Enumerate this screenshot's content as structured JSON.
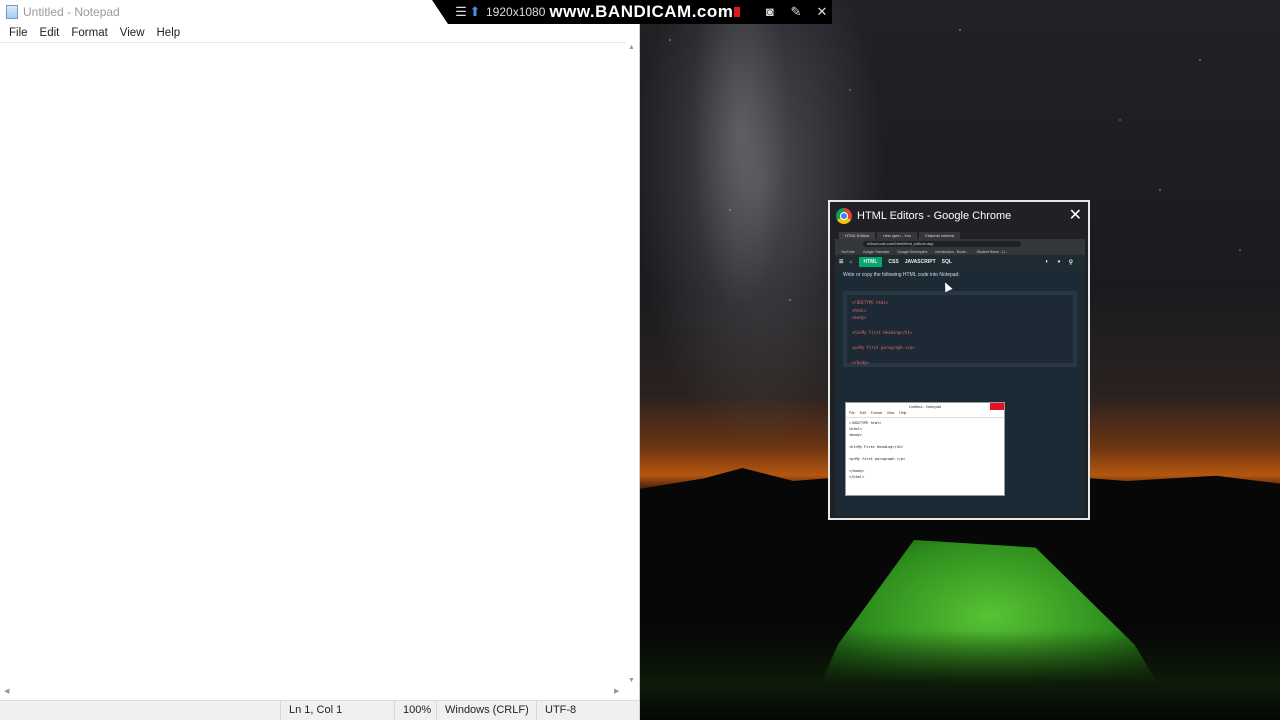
{
  "notepad": {
    "title": "Untitled - Notepad",
    "menu": [
      "File",
      "Edit",
      "Format",
      "View",
      "Help"
    ],
    "editor_text": "",
    "status": {
      "position": "Ln 1, Col 1",
      "zoom": "100%",
      "line_ending": "Windows (CRLF)",
      "encoding": "UTF-8"
    }
  },
  "bandicam": {
    "resolution": "1920x1080",
    "brand": "www.BANDICAM.com",
    "icons": [
      "menu-icon",
      "pin-icon",
      "camera-icon",
      "pencil-icon",
      "close-icon"
    ]
  },
  "chrome_popup": {
    "title": "HTML Editors - Google Chrome",
    "tabs": [
      "HTML Editors",
      "new open - You",
      "Channel content"
    ],
    "address": "w3schools.com/html/html_editors.asp",
    "bookmarks": [
      "YouTube",
      "Google Translate",
      "Google Developers",
      "Introduction - Boots...",
      "Student Home - Ll..."
    ],
    "nav": [
      "HTML",
      "CSS",
      "JAVASCRIPT",
      "SQL"
    ],
    "instruction": "Write or copy the following HTML code into Notepad:",
    "code_lines": [
      "<!DOCTYPE html>",
      "<html>",
      "<body>",
      "",
      "<h1>My First Heading</h1>",
      "",
      "<p>My first paragraph.</p>",
      "",
      "</body>",
      "</html>"
    ],
    "mini_notepad": {
      "title": "Untitled - Notepad",
      "menu": [
        "File",
        "Edit",
        "Format",
        "View",
        "Help"
      ],
      "lines": [
        "<!DOCTYPE html>",
        "<html>",
        "<body>",
        "",
        "<h1>My First Heading</h1>",
        "",
        "<p>My first paragraph.</p>",
        "",
        "</body>",
        "</html>"
      ]
    }
  }
}
